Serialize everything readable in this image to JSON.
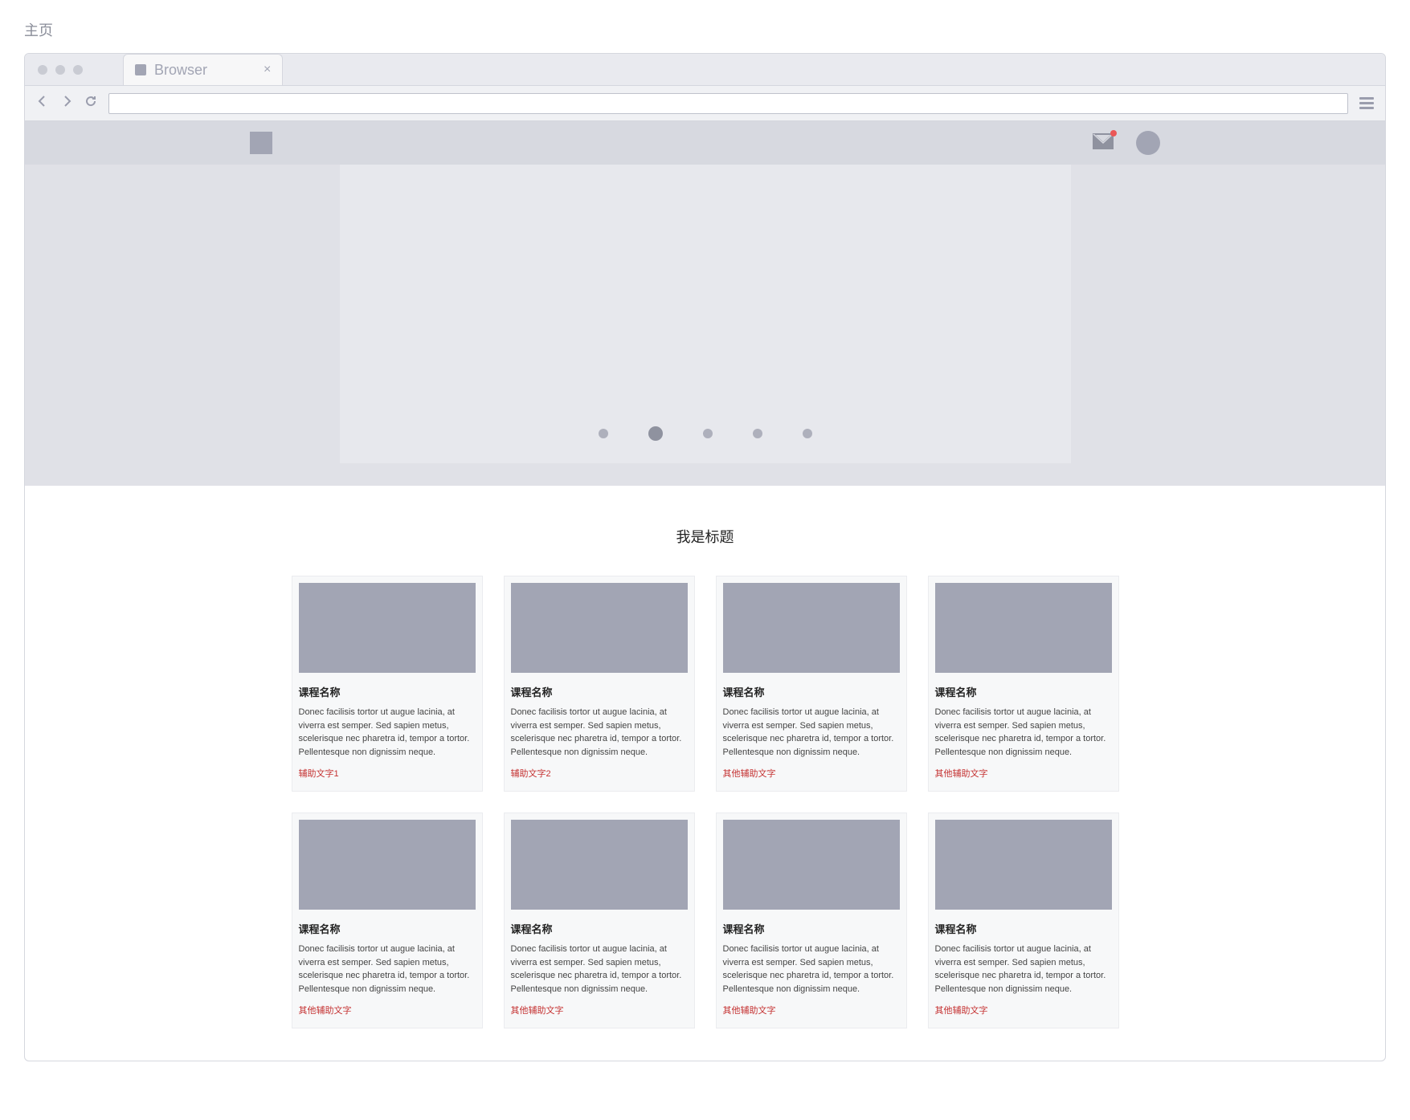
{
  "page_label": "主页",
  "tab": {
    "label": "Browser"
  },
  "carousel": {
    "active_index": 1,
    "dot_count": 5
  },
  "section": {
    "title": "我是标题"
  },
  "cards": [
    {
      "title": "课程名称",
      "desc": "Donec facilisis tortor ut augue lacinia, at viverra est semper. Sed sapien metus, scelerisque nec pharetra id, tempor a tortor. Pellentesque non dignissim neque.",
      "footer": "辅助文字1"
    },
    {
      "title": "课程名称",
      "desc": "Donec facilisis tortor ut augue lacinia, at viverra est semper. Sed sapien metus, scelerisque nec pharetra id, tempor a tortor. Pellentesque non dignissim neque.",
      "footer": "辅助文字2"
    },
    {
      "title": "课程名称",
      "desc": "Donec facilisis tortor ut augue lacinia, at viverra est semper. Sed sapien metus, scelerisque nec pharetra id, tempor a tortor. Pellentesque non dignissim neque.",
      "footer": "其他辅助文字"
    },
    {
      "title": "课程名称",
      "desc": "Donec facilisis tortor ut augue lacinia, at viverra est semper. Sed sapien metus, scelerisque nec pharetra id, tempor a tortor. Pellentesque non dignissim neque.",
      "footer": "其他辅助文字"
    },
    {
      "title": "课程名称",
      "desc": "Donec facilisis tortor ut augue lacinia, at viverra est semper. Sed sapien metus, scelerisque nec pharetra id, tempor a tortor. Pellentesque non dignissim neque.",
      "footer": "其他辅助文字"
    },
    {
      "title": "课程名称",
      "desc": "Donec facilisis tortor ut augue lacinia, at viverra est semper. Sed sapien metus, scelerisque nec pharetra id, tempor a tortor. Pellentesque non dignissim neque.",
      "footer": "其他辅助文字"
    },
    {
      "title": "课程名称",
      "desc": "Donec facilisis tortor ut augue lacinia, at viverra est semper. Sed sapien metus, scelerisque nec pharetra id, tempor a tortor. Pellentesque non dignissim neque.",
      "footer": "其他辅助文字"
    },
    {
      "title": "课程名称",
      "desc": "Donec facilisis tortor ut augue lacinia, at viverra est semper. Sed sapien metus, scelerisque nec pharetra id, tempor a tortor. Pellentesque non dignissim neque.",
      "footer": "其他辅助文字"
    }
  ]
}
